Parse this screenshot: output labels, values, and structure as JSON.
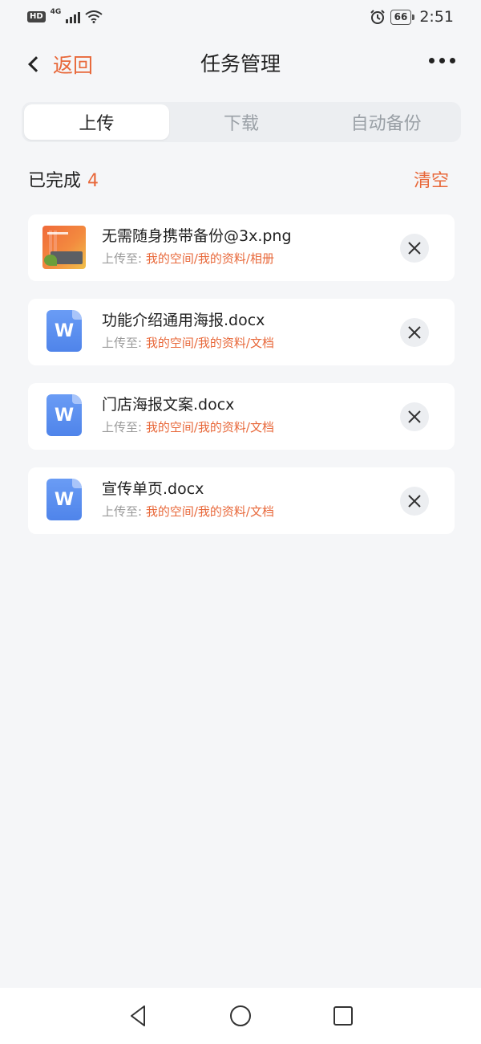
{
  "status_bar": {
    "hd": "HD",
    "network": "4G",
    "battery": "66",
    "time": "2:51"
  },
  "nav": {
    "back_label": "返回",
    "title": "任务管理"
  },
  "tabs": [
    {
      "label": "上传",
      "active": true
    },
    {
      "label": "下载",
      "active": false
    },
    {
      "label": "自动备份",
      "active": false
    }
  ],
  "section": {
    "label": "已完成",
    "count": "4",
    "clear_label": "清空"
  },
  "tasks": [
    {
      "name": "无需随身携带备份@3x.png",
      "dest_prefix": "上传至:",
      "dest_path": "我的空间/我的资料/相册",
      "icon": "image-thumbnail"
    },
    {
      "name": "功能介绍通用海报.docx",
      "dest_prefix": "上传至:",
      "dest_path": "我的空间/我的资料/文档",
      "icon": "word-doc-icon",
      "icon_letter": "W"
    },
    {
      "name": "门店海报文案.docx",
      "dest_prefix": "上传至:",
      "dest_path": "我的空间/我的资料/文档",
      "icon": "word-doc-icon",
      "icon_letter": "W"
    },
    {
      "name": "宣传单页.docx",
      "dest_prefix": "上传至:",
      "dest_path": "我的空间/我的资料/文档",
      "icon": "word-doc-icon",
      "icon_letter": "W"
    }
  ],
  "colors": {
    "accent": "#e8683a",
    "background": "#f5f6f8",
    "doc_icon": "#5b8ef0"
  }
}
